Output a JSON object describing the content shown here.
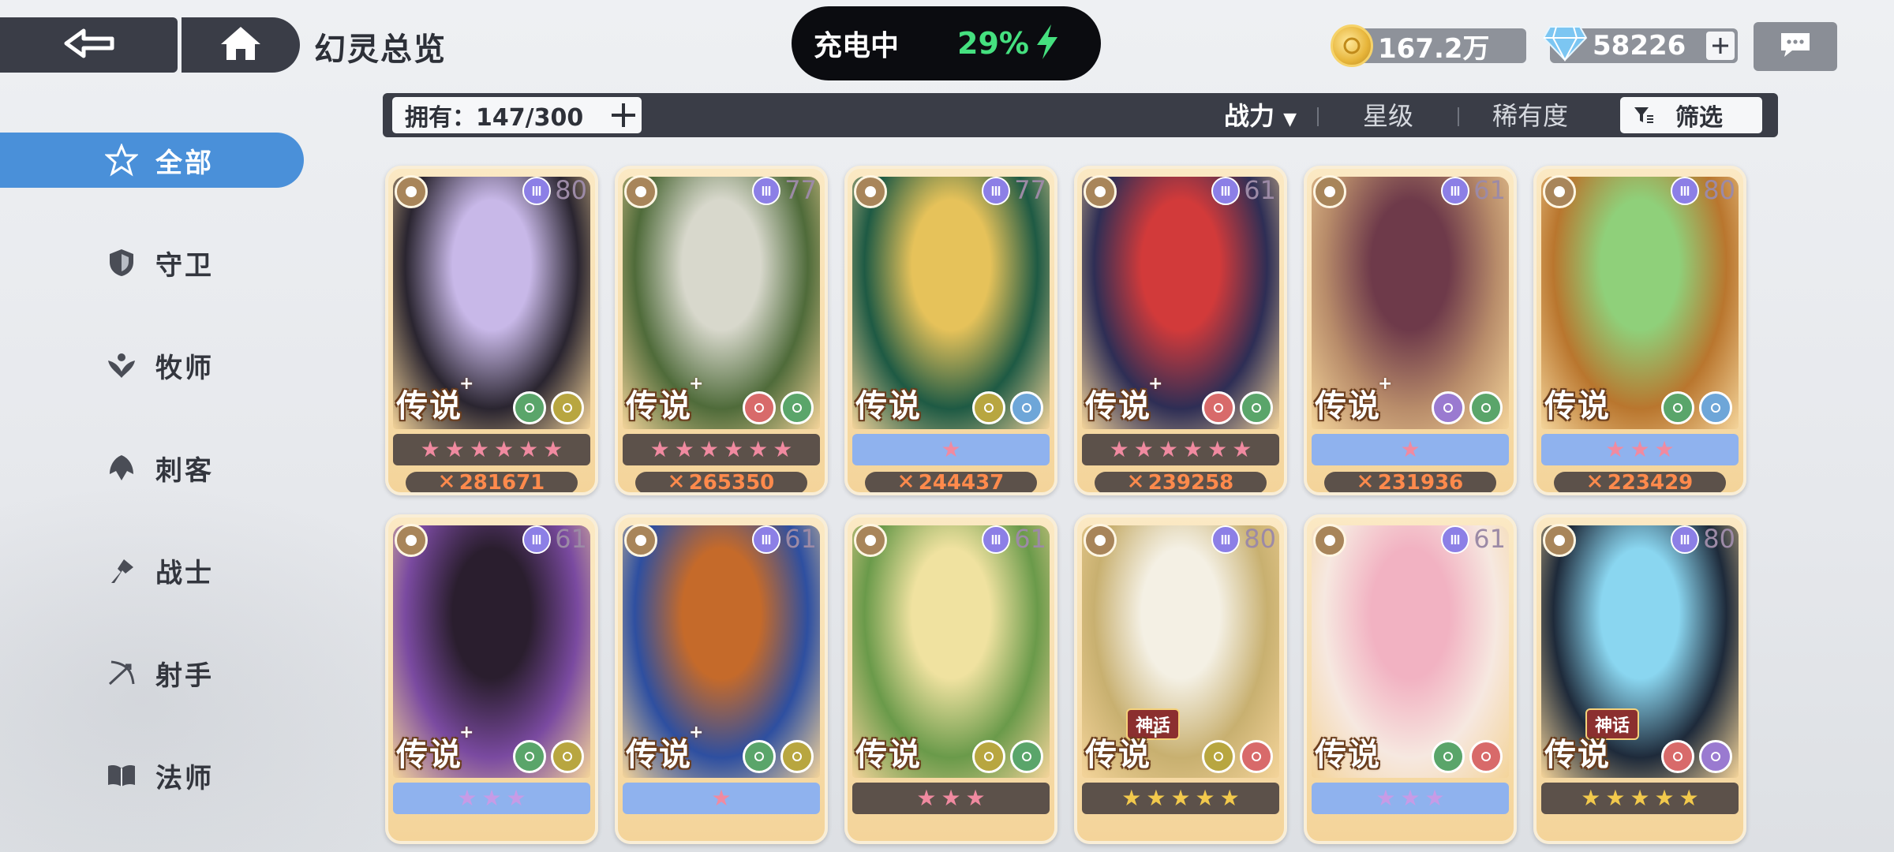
{
  "header": {
    "title": "幻灵总览",
    "charging_label": "充电中",
    "battery_percent": "29%",
    "gold": "167.2万",
    "gems": "58226",
    "icons": {
      "back": "back-arrow-icon",
      "home": "home-icon",
      "chat": "chat-bubble-icon",
      "gold": "gold-coin-icon",
      "gem": "blue-gem-icon",
      "bolt": "lightning-bolt-icon"
    }
  },
  "sidebar": {
    "items": [
      {
        "label": "全部",
        "icon": "all-classes-icon",
        "active": true
      },
      {
        "label": "守卫",
        "icon": "shield-icon",
        "active": false
      },
      {
        "label": "牧师",
        "icon": "priest-icon",
        "active": false
      },
      {
        "label": "刺客",
        "icon": "assassin-icon",
        "active": false
      },
      {
        "label": "战士",
        "icon": "warrior-icon",
        "active": false
      },
      {
        "label": "射手",
        "icon": "archer-icon",
        "active": false
      },
      {
        "label": "法师",
        "icon": "book-icon",
        "active": false
      }
    ]
  },
  "filter_bar": {
    "owned": "拥有：147/300",
    "sort_power": "战力",
    "sort_power_arrow": "▼",
    "sort_star": "星级",
    "sort_rarity": "稀有度",
    "filter": "筛选"
  },
  "colors": {
    "accent": "#4a90d9",
    "dark_panel": "#3a3d47",
    "battery_green": "#45e07f",
    "power_orange": "#ff8a4c",
    "star_pink": "#f08aa0",
    "star_gold": "#f2c94c",
    "star_violet": "#c79be6"
  },
  "cards": [
    {
      "level": "80",
      "rarity": "传说",
      "plus": "+",
      "stars": 6,
      "star_color": "#f08aa0",
      "bar": "dark",
      "power": "281671",
      "class_icon": "book-icon",
      "elements": [
        "leaf-element-icon",
        "wing-element-icon"
      ],
      "palette": [
        "#c8b8e8",
        "#2a2530"
      ]
    },
    {
      "level": "77",
      "rarity": "传说",
      "plus": "+",
      "stars": 6,
      "star_color": "#f08aa0",
      "bar": "dark",
      "power": "265350",
      "class_icon": "shield-icon",
      "elements": [
        "swirl-element-icon",
        "leaf-element-icon"
      ],
      "palette": [
        "#d8d8cc",
        "#4f6b3a"
      ]
    },
    {
      "level": "77",
      "rarity": "传说",
      "plus": "",
      "stars": 1,
      "star_color": "#f08aa0",
      "bar": "blue",
      "power": "244437",
      "class_icon": "shield-icon",
      "elements": [
        "wing-element-icon",
        "frost-element-icon"
      ],
      "palette": [
        "#e6c25a",
        "#1e5a44"
      ]
    },
    {
      "level": "61",
      "rarity": "传说",
      "plus": "+",
      "stars": 6,
      "star_color": "#f08aa0",
      "bar": "dark",
      "power": "239258",
      "class_icon": "warrior-icon",
      "elements": [
        "swirl-element-icon",
        "leaf-element-icon"
      ],
      "palette": [
        "#d23a3a",
        "#2e2e55"
      ]
    },
    {
      "level": "61",
      "rarity": "传说",
      "plus": "+",
      "stars": 1,
      "star_color": "#f08aa0",
      "bar": "blue",
      "power": "231936",
      "class_icon": "assassin-icon",
      "elements": [
        "diamond-element-icon",
        "leaf-element-icon"
      ],
      "palette": [
        "#6e3a4a",
        "#b88c6a"
      ]
    },
    {
      "level": "80",
      "rarity": "传说",
      "plus": "",
      "stars": 3,
      "star_color": "#f08aa0",
      "bar": "blue",
      "power": "223429",
      "class_icon": "book-icon",
      "elements": [
        "leaf-element-icon",
        "frost-element-icon"
      ],
      "palette": [
        "#8fd07a",
        "#b9762e"
      ]
    },
    {
      "level": "61",
      "rarity": "传说",
      "plus": "+",
      "stars": 3,
      "star_color": "#c79be6",
      "bar": "blue",
      "power": "",
      "class_icon": "warrior-icon",
      "elements": [
        "leaf-element-icon",
        "wing-element-icon"
      ],
      "palette": [
        "#2a1e2e",
        "#7a4aa0"
      ]
    },
    {
      "level": "61",
      "rarity": "传说",
      "plus": "+",
      "stars": 1,
      "star_color": "#f08aa0",
      "bar": "blue",
      "power": "",
      "class_icon": "assassin-icon",
      "elements": [
        "leaf-element-icon",
        "wing-element-icon"
      ],
      "palette": [
        "#c56a2a",
        "#2e4fa0"
      ]
    },
    {
      "level": "61",
      "rarity": "传说",
      "plus": "",
      "stars": 3,
      "star_color": "#f08aa0",
      "bar": "dark",
      "power": "",
      "class_icon": "priest-icon",
      "elements": [
        "wing-element-icon",
        "leaf-element-icon"
      ],
      "palette": [
        "#f0e2a0",
        "#6a9a4a"
      ]
    },
    {
      "level": "80",
      "rarity": "传说",
      "plus": "+",
      "stars": 5,
      "star_color": "#f2c94c",
      "bar": "dark",
      "power": "",
      "myth": "神话",
      "class_icon": "book-icon",
      "elements": [
        "wing-element-icon",
        "swirl-element-icon"
      ],
      "palette": [
        "#f4f0e4",
        "#c8b070"
      ]
    },
    {
      "level": "61",
      "rarity": "传说",
      "plus": "",
      "stars": 3,
      "star_color": "#c79be6",
      "bar": "blue",
      "power": "",
      "class_icon": "priest-icon",
      "elements": [
        "leaf-element-icon",
        "swirl-element-icon"
      ],
      "palette": [
        "#f2b2c2",
        "#f6e8e0"
      ]
    },
    {
      "level": "80",
      "rarity": "传说",
      "plus": "",
      "stars": 5,
      "star_color": "#f2c94c",
      "bar": "dark",
      "power": "",
      "myth": "神话",
      "class_icon": "book-icon",
      "elements": [
        "swirl-element-icon",
        "diamond-element-icon"
      ],
      "palette": [
        "#8ad6f0",
        "#1e2a3a"
      ]
    }
  ]
}
